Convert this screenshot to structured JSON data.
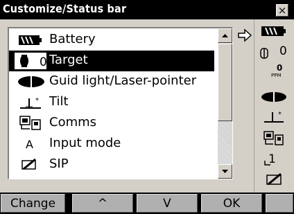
{
  "window": {
    "title": "Customize/Status bar",
    "close_glyph": "×"
  },
  "list": {
    "items": [
      {
        "label": "Battery",
        "icon": "battery-icon"
      },
      {
        "label": "Target",
        "icon": "target-prism-icon",
        "selected": true,
        "prefix": "0"
      },
      {
        "label": "Guid light/Laser-pointer",
        "icon": "guide-light-icon"
      },
      {
        "label": "Tilt",
        "icon": "tilt-icon"
      },
      {
        "label": "Comms",
        "icon": "comms-icon"
      },
      {
        "label": "Input mode",
        "icon": "input-mode-icon",
        "glyph": "A"
      },
      {
        "label": "SIP",
        "icon": "sip-icon"
      }
    ]
  },
  "status_bar": {
    "target_value": "0",
    "ppm_value": "0",
    "ppm_unit": "PPM",
    "input_mode_value": "1"
  },
  "function_keys": [
    "Change",
    "^",
    "V",
    "OK",
    ""
  ]
}
